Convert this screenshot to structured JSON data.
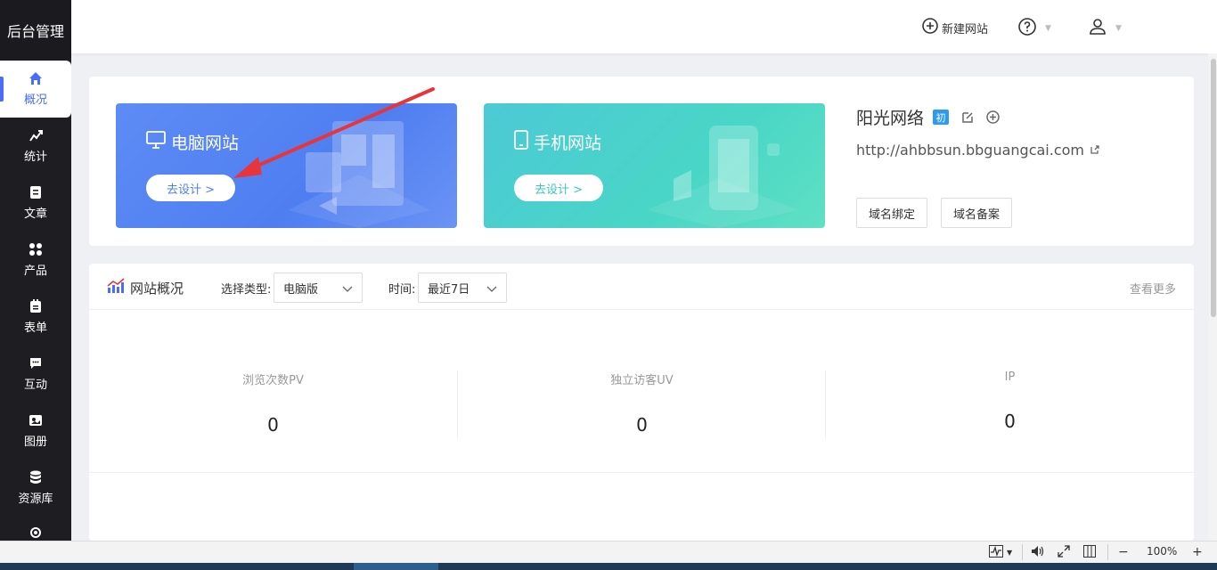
{
  "sidebar": {
    "brand": "后台管理",
    "items": [
      {
        "label": "概况",
        "icon": "home-icon"
      },
      {
        "label": "统计",
        "icon": "chart-icon"
      },
      {
        "label": "文章",
        "icon": "article-icon"
      },
      {
        "label": "产品",
        "icon": "grid-icon"
      },
      {
        "label": "表单",
        "icon": "form-icon"
      },
      {
        "label": "互动",
        "icon": "chat-icon"
      },
      {
        "label": "图册",
        "icon": "album-icon"
      },
      {
        "label": "资源库",
        "icon": "database-icon"
      }
    ]
  },
  "header": {
    "new_site": "新建网站"
  },
  "cards": {
    "pc": {
      "title": "电脑网站",
      "button": "去设计 >"
    },
    "mobile": {
      "title": "手机网站",
      "button": "去设计 >"
    }
  },
  "site": {
    "name": "阳光网络",
    "badge": "初",
    "url": "http://ahbbsun.bbguangcai.com",
    "bind_domain": "域名绑定",
    "icp": "域名备案"
  },
  "overview": {
    "title": "网站概况",
    "type_label": "选择类型:",
    "type_value": "电脑版",
    "time_label": "时间:",
    "time_value": "最近7日",
    "more": "查看更多",
    "stats": [
      {
        "label": "浏览次数PV",
        "value": "0"
      },
      {
        "label": "独立访客UV",
        "value": "0"
      },
      {
        "label": "IP",
        "value": "0"
      }
    ]
  },
  "statusbar": {
    "zoom": "100%"
  },
  "colors": {
    "accent": "#4a6cf7",
    "pc_card": "#5d8cf5",
    "mobile_card": "#4cc9d6",
    "arrow": "#e8343b"
  }
}
